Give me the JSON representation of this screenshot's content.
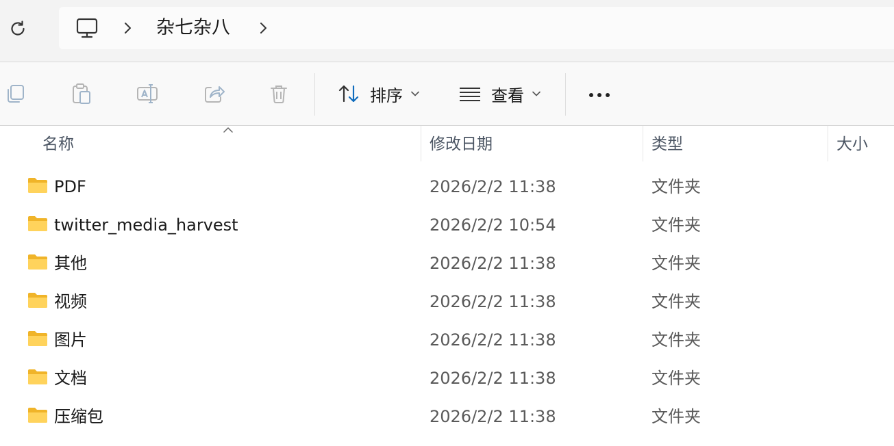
{
  "address_bar": {
    "breadcrumb": "杂七杂八"
  },
  "toolbar": {
    "sort_label": "排序",
    "view_label": "查看"
  },
  "columns": {
    "name": "名称",
    "date_modified": "修改日期",
    "type": "类型",
    "size": "大小"
  },
  "files": [
    {
      "name": "PDF",
      "date": "2026/2/2 11:38",
      "type": "文件夹"
    },
    {
      "name": "twitter_media_harvest",
      "date": "2026/2/2 10:54",
      "type": "文件夹"
    },
    {
      "name": "其他",
      "date": "2026/2/2 11:38",
      "type": "文件夹"
    },
    {
      "name": "视频",
      "date": "2026/2/2 11:38",
      "type": "文件夹"
    },
    {
      "name": "图片",
      "date": "2026/2/2 11:38",
      "type": "文件夹"
    },
    {
      "name": "文档",
      "date": "2026/2/2 11:38",
      "type": "文件夹"
    },
    {
      "name": "压缩包",
      "date": "2026/2/2 11:38",
      "type": "文件夹"
    }
  ],
  "colors": {
    "folder": "#ffc83d",
    "accent": "#0f6cbd"
  },
  "icons": {
    "refresh": "refresh-icon",
    "computer": "computer-icon",
    "copy": "copy-icon",
    "paste": "paste-icon",
    "rename": "rename-icon",
    "share": "share-icon",
    "delete": "delete-icon",
    "sort": "sort-icon",
    "view": "view-icon",
    "more": "more-icon",
    "folder": "folder-icon"
  }
}
